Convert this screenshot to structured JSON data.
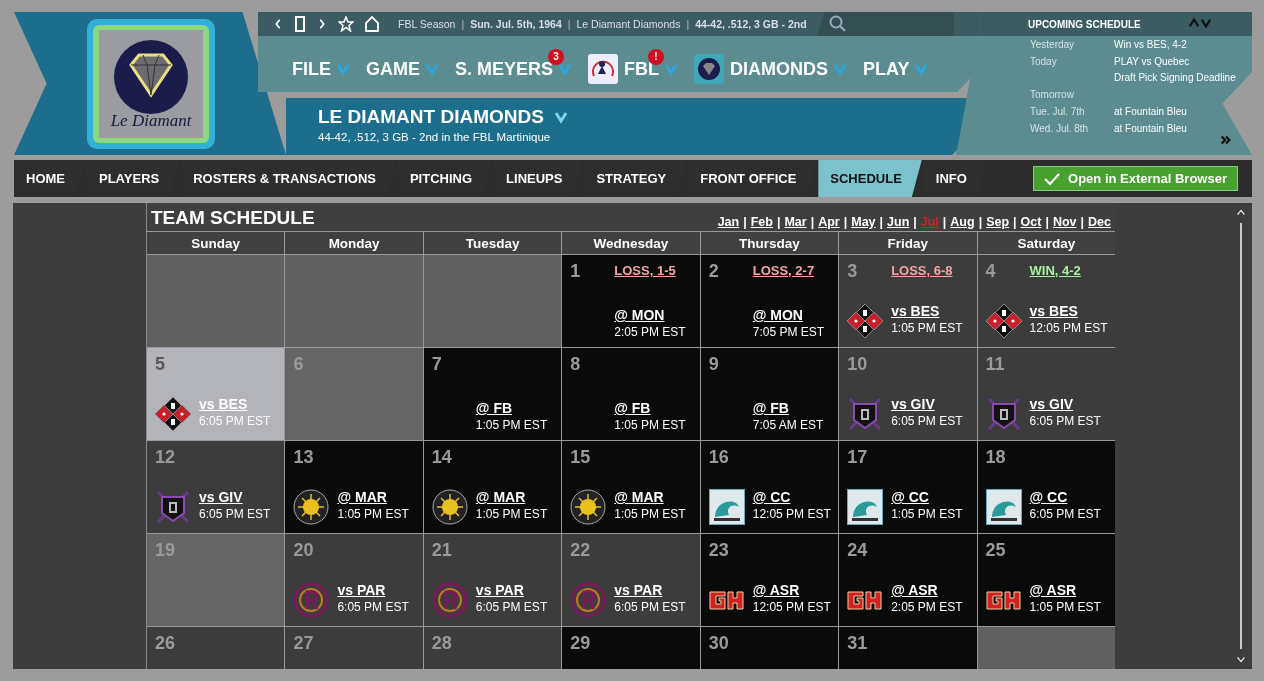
{
  "team_logo": {
    "caption": "Le Diamant"
  },
  "breadcrumb": {
    "separator": "|",
    "items": [
      "FBL Season",
      "Sun. Jul. 5th, 1964",
      "Le Diamant Diamonds",
      "44-42, .512, 3 GB - 2nd"
    ]
  },
  "menus": [
    {
      "label": "FILE"
    },
    {
      "label": "GAME"
    },
    {
      "label": "S. MEYERS",
      "badge": "3"
    },
    {
      "label": "FBL",
      "badge": "!",
      "logo": {
        "kind": "league"
      }
    },
    {
      "label": "DIAMONDS",
      "logo": {
        "kind": "team"
      }
    },
    {
      "label": "PLAY"
    }
  ],
  "team": {
    "name": "LE DIAMANT DIAMONDS",
    "record": "44-42, .512, 3 GB - 2nd in the FBL Martinique"
  },
  "upcoming": {
    "title": "UPCOMING SCHEDULE",
    "rows": [
      {
        "label": "Yesterday",
        "values": [
          "Win vs BES, 4-2"
        ]
      },
      {
        "label": "Today",
        "values": [
          "PLAY vs Quebec",
          "Draft Pick Signing Deadline"
        ]
      },
      {
        "label": "Tomorrow"
      },
      {
        "label": "Tue. Jul. 7th",
        "values": [
          "at Fountain Bleu"
        ]
      },
      {
        "label": "Wed. Jul. 8th",
        "values": [
          "at Fountain Bleu"
        ]
      }
    ]
  },
  "tabs": [
    {
      "label": "HOME",
      "selected": false
    },
    {
      "label": "PLAYERS",
      "selected": false
    },
    {
      "label": "ROSTERS & TRANSACTIONS",
      "selected": false
    },
    {
      "label": "PITCHING",
      "selected": false
    },
    {
      "label": "LINEUPS",
      "selected": false
    },
    {
      "label": "STRATEGY",
      "selected": false
    },
    {
      "label": "FRONT OFFICE",
      "selected": false
    },
    {
      "label": "SCHEDULE",
      "selected": true
    },
    {
      "label": "INFO",
      "selected": false
    }
  ],
  "external_button": {
    "label": "Open in External Browser"
  },
  "schedule": {
    "title": "TEAM SCHEDULE",
    "month_separator": "|",
    "months": [
      {
        "label": "Jan",
        "selected": false
      },
      {
        "label": "Feb",
        "selected": false
      },
      {
        "label": "Mar",
        "selected": false
      },
      {
        "label": "Apr",
        "selected": false
      },
      {
        "label": "May",
        "selected": false
      },
      {
        "label": "Jun",
        "selected": false
      },
      {
        "label": "Jul",
        "selected": true
      },
      {
        "label": "Aug",
        "selected": false
      },
      {
        "label": "Sep",
        "selected": false
      },
      {
        "label": "Oct",
        "selected": false
      },
      {
        "label": "Nov",
        "selected": false
      },
      {
        "label": "Dec",
        "selected": false
      }
    ],
    "weekdays": [
      "Sunday",
      "Monday",
      "Tuesday",
      "Wednesday",
      "Thursday",
      "Friday",
      "Saturday"
    ],
    "cells": [
      {
        "kind": "blank"
      },
      {
        "kind": "blank"
      },
      {
        "kind": "blank"
      },
      {
        "kind": "away",
        "day": "1",
        "selected": false,
        "result": "LOSS, 1-5",
        "color": "#f4a4a4",
        "opponent": "@ MON",
        "time": "2:05 PM EST"
      },
      {
        "kind": "away",
        "day": "2",
        "selected": false,
        "result": "LOSS, 2-7",
        "color": "#f4a4a4",
        "opponent": "@ MON",
        "time": "7:05 PM EST"
      },
      {
        "kind": "home",
        "day": "3",
        "selected": false,
        "result": "LOSS, 6-8",
        "color": "#f4a4a4",
        "opponent": "vs BES",
        "time": "1:05 PM EST",
        "logo": {
          "kind": "diamonds"
        }
      },
      {
        "kind": "home",
        "day": "4",
        "selected": false,
        "result": "WIN, 4-2",
        "color": "#a8f0a0",
        "opponent": "vs BES",
        "time": "12:05 PM EST",
        "logo": {
          "kind": "diamonds"
        }
      },
      {
        "kind": "home",
        "day": "5",
        "selected": true,
        "opponent": "vs BES",
        "time": "6:05 PM EST",
        "logo": {
          "kind": "diamonds"
        }
      },
      {
        "kind": "off",
        "day": "6",
        "selected": false
      },
      {
        "kind": "away",
        "day": "7",
        "selected": false,
        "opponent": "@ FB",
        "time": "1:05 PM EST"
      },
      {
        "kind": "away",
        "day": "8",
        "selected": false,
        "opponent": "@ FB",
        "time": "1:05 PM EST"
      },
      {
        "kind": "away",
        "day": "9",
        "selected": false,
        "opponent": "@ FB",
        "time": "7:05 AM EST"
      },
      {
        "kind": "home",
        "day": "10",
        "selected": false,
        "opponent": "vs GIV",
        "time": "6:05 PM EST",
        "logo": {
          "kind": "shield"
        }
      },
      {
        "kind": "home",
        "day": "11",
        "selected": false,
        "opponent": "vs GIV",
        "time": "6:05 PM EST",
        "logo": {
          "kind": "shield"
        }
      },
      {
        "kind": "home",
        "day": "12",
        "selected": false,
        "opponent": "vs GIV",
        "time": "6:05 PM EST",
        "logo": {
          "kind": "shield"
        }
      },
      {
        "kind": "away",
        "day": "13",
        "selected": false,
        "opponent": "@ MAR",
        "time": "1:05 PM EST",
        "logo": {
          "kind": "sun"
        }
      },
      {
        "kind": "away",
        "day": "14",
        "selected": false,
        "opponent": "@ MAR",
        "time": "1:05 PM EST",
        "logo": {
          "kind": "sun"
        }
      },
      {
        "kind": "away",
        "day": "15",
        "selected": false,
        "opponent": "@ MAR",
        "time": "1:05 PM EST",
        "logo": {
          "kind": "sun"
        }
      },
      {
        "kind": "away",
        "day": "16",
        "selected": false,
        "opponent": "@ CC",
        "time": "12:05 PM EST",
        "logo": {
          "kind": "wave"
        }
      },
      {
        "kind": "away",
        "day": "17",
        "selected": false,
        "opponent": "@ CC",
        "time": "1:05 PM EST",
        "logo": {
          "kind": "wave"
        }
      },
      {
        "kind": "away",
        "day": "18",
        "selected": false,
        "opponent": "@ CC",
        "time": "6:05 PM EST",
        "logo": {
          "kind": "wave"
        }
      },
      {
        "kind": "off",
        "day": "19",
        "selected": false
      },
      {
        "kind": "home",
        "day": "20",
        "selected": false,
        "opponent": "vs PAR",
        "time": "6:05 PM EST",
        "logo": {
          "kind": "ring"
        }
      },
      {
        "kind": "home",
        "day": "21",
        "selected": false,
        "opponent": "vs PAR",
        "time": "6:05 PM EST",
        "logo": {
          "kind": "ring"
        }
      },
      {
        "kind": "home",
        "day": "22",
        "selected": false,
        "opponent": "vs PAR",
        "time": "6:05 PM EST",
        "logo": {
          "kind": "ring"
        }
      },
      {
        "kind": "away",
        "day": "23",
        "selected": false,
        "opponent": "@ ASR",
        "time": "12:05 PM EST",
        "logo": {
          "kind": "block"
        }
      },
      {
        "kind": "away",
        "day": "24",
        "selected": false,
        "opponent": "@ ASR",
        "time": "2:05 PM EST",
        "logo": {
          "kind": "block"
        }
      },
      {
        "kind": "away",
        "day": "25",
        "selected": false,
        "opponent": "@ ASR",
        "time": "1:05 PM EST",
        "logo": {
          "kind": "block"
        }
      },
      {
        "kind": "home",
        "day": "26",
        "selected": false
      },
      {
        "kind": "home",
        "day": "27",
        "selected": false
      },
      {
        "kind": "home",
        "day": "28",
        "selected": false
      },
      {
        "kind": "away",
        "day": "29",
        "selected": false
      },
      {
        "kind": "away",
        "day": "30",
        "selected": false
      },
      {
        "kind": "away",
        "day": "31",
        "selected": false
      },
      {
        "kind": "blank"
      }
    ]
  }
}
